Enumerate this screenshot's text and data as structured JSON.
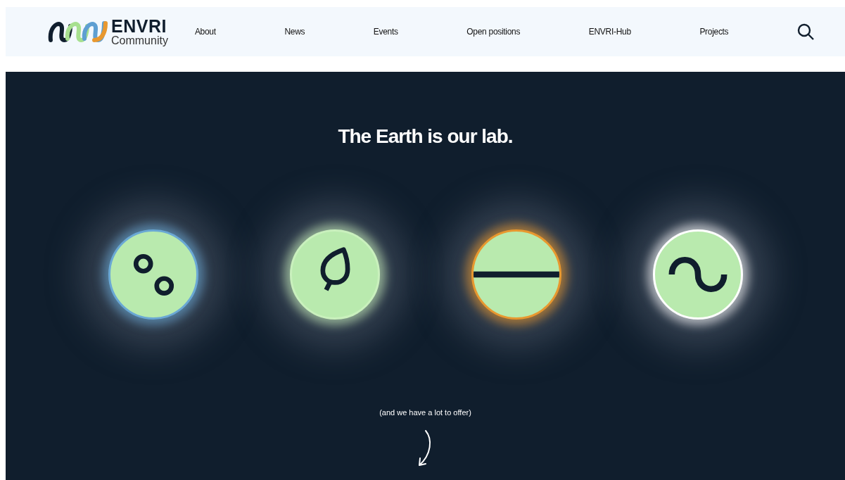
{
  "header": {
    "logo": {
      "title": "ENVRI",
      "subtitle": "Community"
    },
    "nav": [
      "About",
      "News",
      "Events",
      "Open positions",
      "ENVRI-Hub",
      "Projects"
    ]
  },
  "hero": {
    "title": "The Earth is our lab.",
    "domains": [
      {
        "kind": "atmosphere",
        "color": "#6aa8d4"
      },
      {
        "kind": "biosphere",
        "color": "#c9f0bd"
      },
      {
        "kind": "solid-earth",
        "color": "#e8982f"
      },
      {
        "kind": "marine",
        "color": "#ffffff"
      }
    ],
    "tagline": "(and we have a lot to offer)"
  }
}
